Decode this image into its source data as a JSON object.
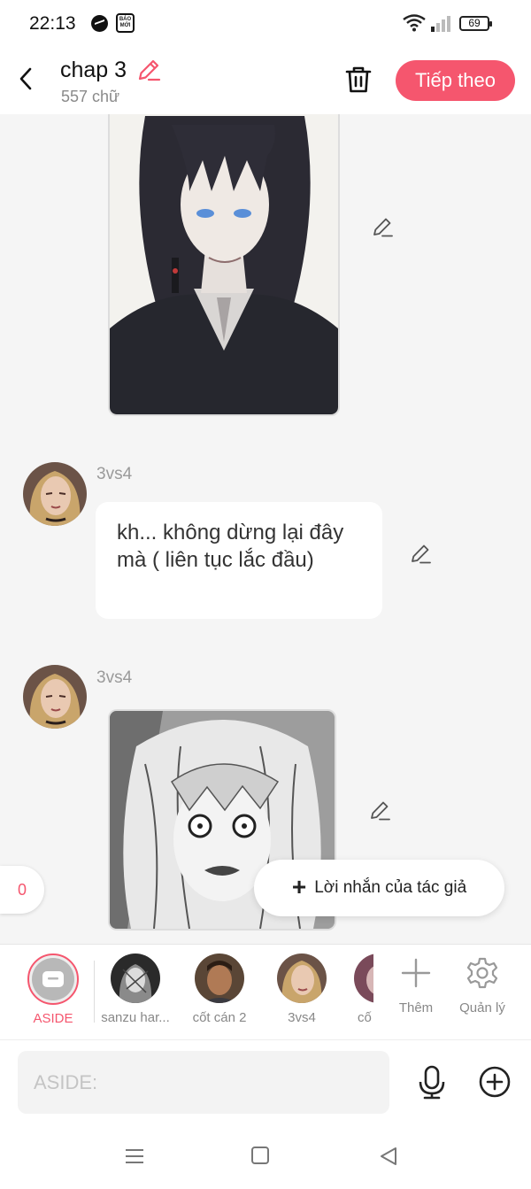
{
  "status_bar": {
    "time": "22:13",
    "battery": "69",
    "baomoi_badge": "BÁO MỚI"
  },
  "header": {
    "title": "chap 3",
    "subtitle": "557 chữ",
    "next_label": "Tiếp theo"
  },
  "messages": [
    {
      "type": "image"
    },
    {
      "type": "text",
      "sender": "3vs4",
      "text": "kh... không dừng lại đây mà ( liên tục lắc đầu)"
    },
    {
      "type": "image",
      "sender": "3vs4"
    }
  ],
  "floating": {
    "count": "0",
    "author_note_label": "Lời nhắn của tác giả"
  },
  "characters": [
    {
      "label": "ASIDE",
      "selected": true
    },
    {
      "label": "sanzu har..."
    },
    {
      "label": "cốt cán 2"
    },
    {
      "label": "3vs4"
    },
    {
      "label": "cố"
    }
  ],
  "tools": {
    "add_label": "Thêm",
    "manage_label": "Quản lý"
  },
  "input": {
    "placeholder": "ASIDE:"
  },
  "colors": {
    "accent": "#f5566e",
    "background": "#f5f5f5"
  }
}
